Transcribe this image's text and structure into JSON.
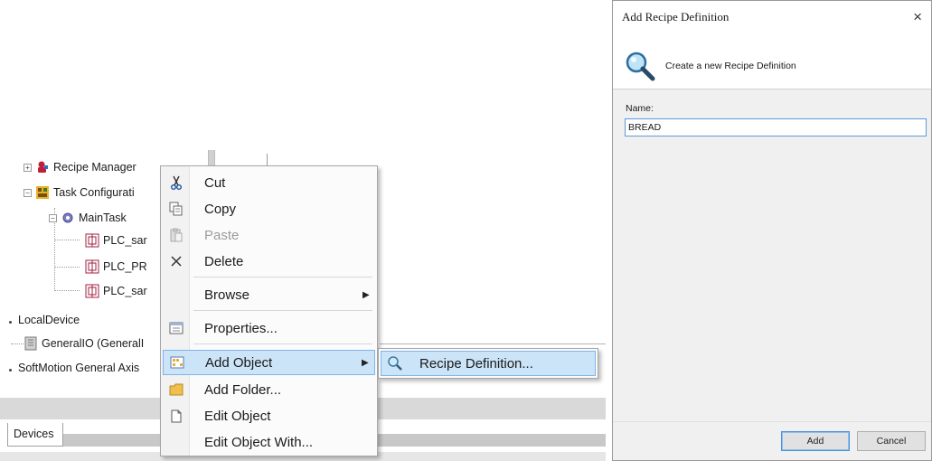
{
  "tree": {
    "items": [
      {
        "label": "Recipe Manager"
      },
      {
        "label": "Task Configurati"
      },
      {
        "label": "MainTask"
      },
      {
        "label": "PLC_sar"
      },
      {
        "label": "PLC_PR"
      },
      {
        "label": "PLC_sar"
      },
      {
        "label": "LocalDevice"
      },
      {
        "label": "GeneralIO (GeneralI"
      },
      {
        "label": "SoftMotion General Axis"
      }
    ],
    "bottom_tab": "Devices"
  },
  "context_menu": {
    "items": [
      {
        "label": "Cut",
        "icon": "scissors-icon",
        "enabled": true
      },
      {
        "label": "Copy",
        "icon": "copy-icon",
        "enabled": true
      },
      {
        "label": "Paste",
        "icon": "paste-icon",
        "enabled": false
      },
      {
        "label": "Delete",
        "icon": "delete-x-icon",
        "enabled": true
      },
      {
        "label": "Browse",
        "has_submenu": true
      },
      {
        "label": "Properties...",
        "icon": "properties-icon"
      },
      {
        "label": "Add Object",
        "icon": "add-object-icon",
        "has_submenu": true,
        "selected": true
      },
      {
        "label": "Add Folder...",
        "icon": "folder-icon"
      },
      {
        "label": "Edit Object",
        "icon": "edit-object-icon"
      },
      {
        "label": "Edit Object With..."
      }
    ],
    "submenu": {
      "label": "Recipe Definition...",
      "icon": "magnifier-icon"
    }
  },
  "dialog": {
    "title": "Add Recipe Definition",
    "subtitle": "Create a new Recipe Definition",
    "name_label": "Name:",
    "name_value": "BREAD",
    "add_label": "Add",
    "cancel_label": "Cancel",
    "close_glyph": "×"
  },
  "colors": {
    "selection_bg": "#cce4f7",
    "selection_border": "#7eb4ea",
    "input_border": "#5a9bd8"
  }
}
